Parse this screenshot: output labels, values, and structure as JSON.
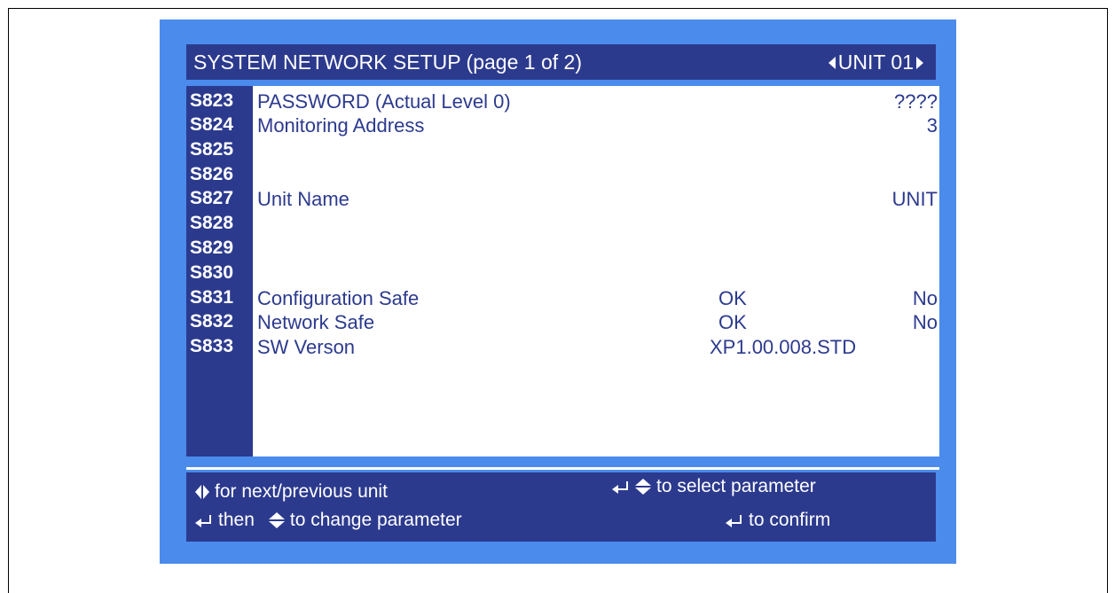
{
  "header": {
    "title": "SYSTEM NETWORK SETUP (page 1 of 2)",
    "unit_label": "UNIT 01"
  },
  "rows": [
    {
      "code": "S823",
      "label": "PASSWORD  (Actual Level  0)",
      "mid": "",
      "value": "????"
    },
    {
      "code": "S824",
      "label": "Monitoring Address",
      "mid": "",
      "value": "3"
    },
    {
      "code": "S825",
      "label": "",
      "mid": "",
      "value": ""
    },
    {
      "code": "S826",
      "label": "",
      "mid": "",
      "value": ""
    },
    {
      "code": "S827",
      "label": "Unit Name",
      "mid": "",
      "value": "UNIT"
    },
    {
      "code": "S828",
      "label": "",
      "mid": "",
      "value": ""
    },
    {
      "code": "S829",
      "label": "",
      "mid": "",
      "value": ""
    },
    {
      "code": "S830",
      "label": "",
      "mid": "",
      "value": ""
    },
    {
      "code": "S831",
      "label": "Configuration Safe",
      "mid": "OK",
      "value": "No"
    },
    {
      "code": "S832",
      "label": "Network Safe",
      "mid": "OK",
      "value": "No"
    },
    {
      "code": "S833",
      "label": "SW Verson",
      "mid": "XP1.00.008.STD",
      "value": ""
    }
  ],
  "footer": {
    "next_prev": "for next/previous unit",
    "select": "to select parameter",
    "change_then": "then",
    "change": "to change parameter",
    "confirm": "to confirm"
  },
  "icons": [
    "left-right-arrows-icon",
    "enter-icon",
    "up-down-arrows-icon"
  ],
  "colors": {
    "screen_bg": "#4a8bec",
    "panel": "#2c3a8e",
    "text": "#2c3a8e",
    "content_bg": "#ffffff"
  }
}
